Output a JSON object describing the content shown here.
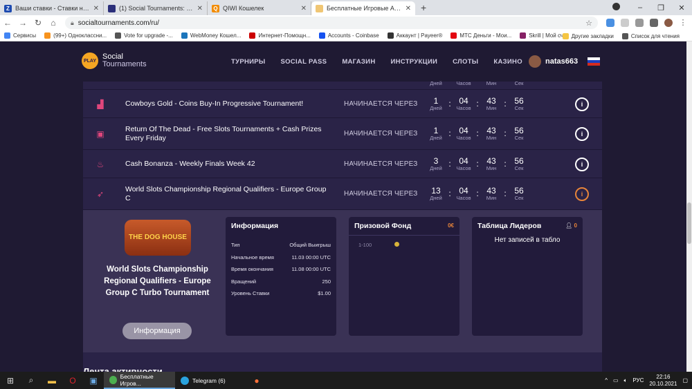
{
  "browser": {
    "tabs": [
      {
        "label": "Ваши ставки - Ставки на спорт",
        "color": "#1e4bb0",
        "glyph": "Z"
      },
      {
        "label": "(1) Social Tournaments: турниры",
        "color": "#2b2f7a",
        "glyph": ""
      },
      {
        "label": "QIWI Кошелек",
        "color": "#f28c00",
        "glyph": "Q"
      },
      {
        "label": "Бесплатные Игровые Автоматы",
        "color": "#f0c674",
        "glyph": "",
        "active": true
      }
    ],
    "new_tab": "+",
    "url": "socialtournaments.com/ru/",
    "bookmarks": [
      {
        "label": "Сервисы",
        "color": "#4285f4"
      },
      {
        "label": "(99+) Одноклассни...",
        "color": "#f7931e"
      },
      {
        "label": "Vote for upgrade -...",
        "color": "#555"
      },
      {
        "label": "WebMoney Кошел...",
        "color": "#1b75bb"
      },
      {
        "label": "Интернет-Помощн...",
        "color": "#c00"
      },
      {
        "label": "Accounts - Coinbase",
        "color": "#1652f0"
      },
      {
        "label": "Аккаунт | Payeer®",
        "color": "#333"
      },
      {
        "label": "МТС Деньги - Мои...",
        "color": "#e30611"
      },
      {
        "label": "Skrill | Мой счет",
        "color": "#862165"
      }
    ],
    "bookmarks_right": [
      {
        "label": "Другие закладки",
        "color": "#f5c542"
      },
      {
        "label": "Список для чтения",
        "color": "#555"
      }
    ]
  },
  "site": {
    "logo_badge": "PLAY",
    "logo_line1": "Social",
    "logo_line2": "Tournaments",
    "nav": [
      "ТУРНИРЫ",
      "SOCIAL PASS",
      "МАГАЗИН",
      "ИНСТРУКЦИИ",
      "СЛОТЫ",
      "КАЗИНО"
    ],
    "username": "natas663",
    "partial_row_labels": [
      "Дней",
      "Часов",
      "Мин",
      "Сек"
    ],
    "tournaments": [
      {
        "name": "Cowboys Gold - Coins Buy-In Progressive Tournament!",
        "icon": "bar-chart-icon",
        "glyph": "▟",
        "starts": "НАЧИНАЕТСЯ ЧЕРЕЗ",
        "d": "1",
        "h": "04",
        "m": "43",
        "s": "56",
        "info_color": "white"
      },
      {
        "name": "Return Of The Dead - Free Slots Tournaments + Cash Prizes Every Friday",
        "icon": "calendar-icon",
        "glyph": "▣",
        "starts": "НАЧИНАЕТСЯ ЧЕРЕЗ",
        "d": "1",
        "h": "04",
        "m": "43",
        "s": "56",
        "info_color": "white"
      },
      {
        "name": "Cash Bonanza - Weekly Finals Week 42",
        "icon": "flame-icon",
        "glyph": "♨",
        "starts": "НАЧИНАЕТСЯ ЧЕРЕЗ",
        "d": "3",
        "h": "04",
        "m": "43",
        "s": "56",
        "info_color": "white"
      },
      {
        "name": "World Slots Championship Regional Qualifiers - Europe Group C",
        "icon": "rocket-icon",
        "glyph": "➶",
        "starts": "НАЧИНАЕТСЯ ЧЕРЕЗ",
        "d": "13",
        "h": "04",
        "m": "43",
        "s": "56",
        "info_color": "orange"
      }
    ],
    "countdown_labels": {
      "d": "Дней",
      "h": "Часов",
      "m": "Мин",
      "s": "Сек"
    },
    "info_glyph": "i",
    "detail": {
      "game_logo": "THE DOG HOUSE",
      "title": "World Slots Championship Regional Qualifiers - Europe Group C Turbo Tournament",
      "info_button": "Информация",
      "info_panel": {
        "heading": "Информация",
        "rows": [
          {
            "k": "Тип",
            "v": "Общий Выигрыш"
          },
          {
            "k": "Начальное время",
            "v": "11.03 00:00 UTC"
          },
          {
            "k": "Время окончания",
            "v": "11.08 00:00 UTC"
          },
          {
            "k": "Вращений",
            "v": "250"
          },
          {
            "k": "Уровень Ставки",
            "v": "$1.00"
          }
        ]
      },
      "prize_panel": {
        "heading": "Призовой Фонд",
        "total": "0€",
        "row_label": "1-100"
      },
      "leaders_panel": {
        "heading": "Таблица Лидеров",
        "count": "0",
        "empty": "Нет записей в табло"
      }
    },
    "activity_heading": "Лента активности"
  },
  "taskbar": {
    "apps": [
      {
        "label": "Бесплатные Игров...",
        "color": "#4caf50",
        "active": true
      },
      {
        "label": "Telegram (6)",
        "color": "#2aa3de",
        "active": false
      }
    ],
    "lang": "РУС",
    "time": "22:16",
    "date": "20.10.2021"
  }
}
